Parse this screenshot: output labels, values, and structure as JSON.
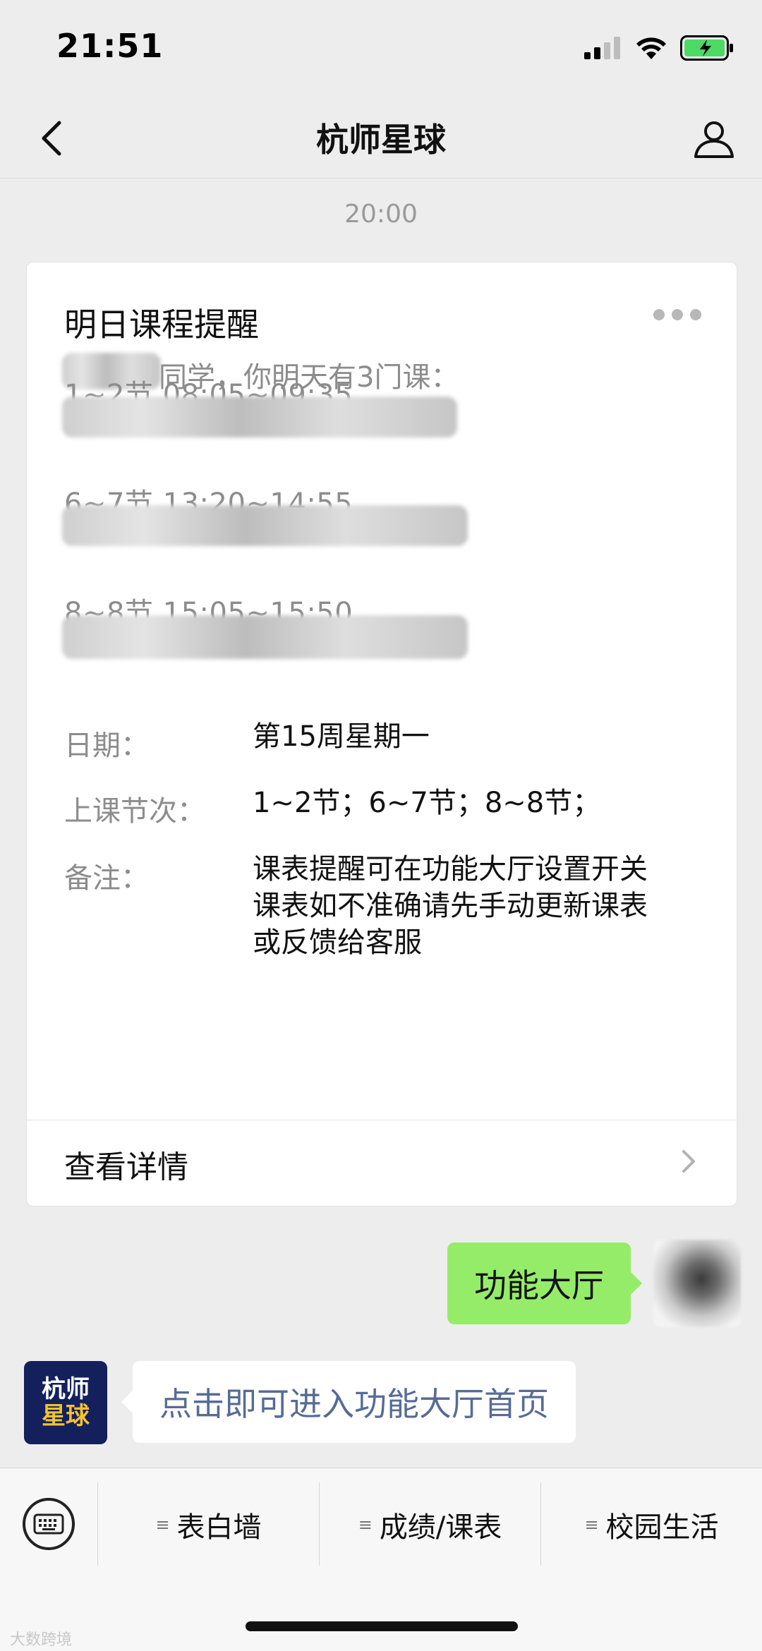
{
  "status_bar": {
    "time": "21:51"
  },
  "nav": {
    "title": "杭师星球",
    "back_icon": "chevron-left-icon",
    "profile_icon": "person-icon"
  },
  "chat": {
    "timestamp": "20:00",
    "card": {
      "title": "明日课程提醒",
      "greeting": "同学，你明天有3门课：",
      "courses": [
        {
          "time": "1~2节  08:05~09:35"
        },
        {
          "time": "6~7节  13:20~14:55"
        },
        {
          "time": "8~8节  15:05~15:50"
        }
      ],
      "fields": [
        {
          "label": "日期：",
          "value": "第15周星期一"
        },
        {
          "label": "上课节次：",
          "value": "1~2节；6~7节；8~8节；"
        },
        {
          "label": "备注：",
          "value": "课表提醒可在功能大厅设置开关\n课表如不准确请先手动更新课表\n或反馈给客服"
        }
      ],
      "link_label": "查看详情"
    },
    "sent_message": "功能大厅",
    "bot_avatar": {
      "line1": "杭师",
      "line2": "星球"
    },
    "received_message": "点击即可进入功能大厅首页"
  },
  "bottom_menu": {
    "items": [
      {
        "label": "表白墙",
        "icon": "≡"
      },
      {
        "label": "成绩/课表",
        "icon": "≡"
      },
      {
        "label": "校园生活",
        "icon": "≡"
      }
    ]
  },
  "watermark": "大数跨境",
  "colors": {
    "background": "#ededed",
    "sent_bubble": "#95ec69",
    "link_text": "#576b95",
    "avatar_bg": "#14205c"
  }
}
